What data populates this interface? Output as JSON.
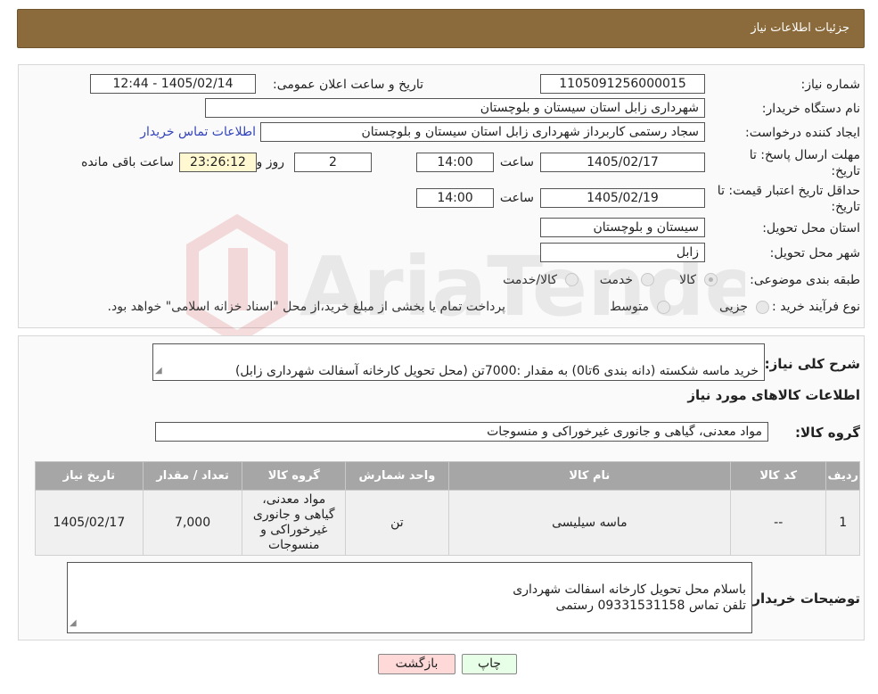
{
  "header": {
    "title": "جزئیات اطلاعات نیاز"
  },
  "form": {
    "need_number_label": "شماره نیاز:",
    "need_number": "1105091256000015",
    "announce_label": "تاریخ و ساعت اعلان عمومی:",
    "announce_value": "1405/02/14 - 12:44",
    "buyer_org_label": "نام دستگاه خریدار:",
    "buyer_org": "شهرداری زابل استان سیستان و بلوچستان",
    "creator_label": "ایجاد کننده درخواست:",
    "creator": "سجاد رستمی کاربرداز شهرداری زابل استان سیستان و بلوچستان",
    "contact_link": "اطلاعات تماس خریدار",
    "deadline_label": "مهلت ارسال پاسخ: تا تاریخ:",
    "deadline_date": "1405/02/17",
    "time_label": "ساعت",
    "deadline_time": "14:00",
    "days_value": "2",
    "days_label": "روز و",
    "remaining_time": "23:26:12",
    "remaining_label": "ساعت باقی مانده",
    "validity_label": "حداقل تاریخ اعتبار قیمت: تا تاریخ:",
    "validity_date": "1405/02/19",
    "validity_time": "14:00",
    "province_label": "استان محل تحویل:",
    "province": "سیستان و بلوچستان",
    "city_label": "شهر محل تحویل:",
    "city": "زابل",
    "category_label": "طبقه بندی موضوعی:",
    "category_options": [
      "کالا",
      "خدمت",
      "کالا/خدمت"
    ],
    "process_label": "نوع فرآیند خرید :",
    "process_options": [
      "جزیی",
      "متوسط"
    ],
    "process_note": "پرداخت تمام یا بخشی از مبلغ خرید،از محل \"اسناد خزانه اسلامی\" خواهد بود."
  },
  "details": {
    "summary_label": "شرح کلی نیاز:",
    "summary": "خرید ماسه شکسته (دانه بندی 6تا0) به مقدار :7000تن (محل تحویل کارخانه آسفالت شهرداری زابل)",
    "goods_info_title": "اطلاعات کالاهای مورد نیاز",
    "goods_group_label": "گروه کالا:",
    "goods_group": "مواد معدنی، گیاهی و جانوری غیرخوراکی و منسوجات",
    "table_headers": [
      "ردیف",
      "کد کالا",
      "نام کالا",
      "واحد شمارش",
      "گروه کالا",
      "تعداد / مقدار",
      "تاریخ نیاز"
    ],
    "table_rows": [
      [
        "1",
        "--",
        "ماسه سیلیسی",
        "تن",
        "مواد معدنی، گیاهی و جانوری غیرخوراکی و منسوجات",
        "7,000",
        "1405/02/17"
      ]
    ],
    "buyer_notes_label": "توضیحات خریدار:",
    "buyer_notes": "باسلام  محل تحویل کارخانه اسفالت شهرداری\nتلفن تماس  09331531158  رستمی"
  },
  "buttons": {
    "print": "چاپ",
    "back": "بازگشت"
  },
  "watermark": {
    "text": "AriaTender.neT"
  },
  "colors": {
    "header_bg": "#8b6a3b",
    "table_header_bg": "#a6a6a6",
    "link": "#3344bb",
    "back_button_bg": "#ffd8d8",
    "print_button_bg": "#e6ffe6"
  }
}
